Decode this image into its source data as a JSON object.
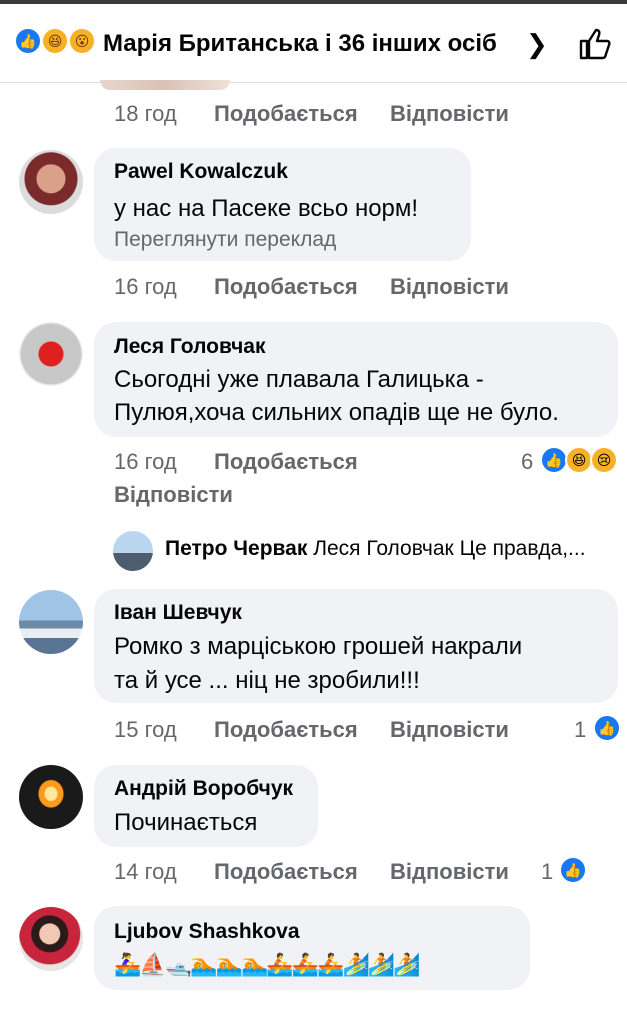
{
  "header": {
    "title": "Марія Британська і 36 інших осіб",
    "reactions": [
      "like-icon",
      "haha-icon",
      "wow-icon"
    ]
  },
  "actions": {
    "like": "Подобається",
    "reply": "Відповісти"
  },
  "top_meta": {
    "time": "18 год"
  },
  "comments": [
    {
      "author": "Pawel Kowalczuk",
      "text": [
        "у нас на Пасеке всьо норм!"
      ],
      "translate": "Переглянути переклад",
      "time": "16 год"
    },
    {
      "author": "Леся Головчак",
      "text": [
        "Сьогодні уже  плавала Галицька -",
        "Пулюя,хоча сильних опадів ще не було."
      ],
      "time": "16 год",
      "reaction_count": "6",
      "reactions": [
        "like-icon",
        "haha-icon",
        "sad-icon"
      ]
    },
    {
      "author": "Іван Шевчук",
      "text": [
        "Ромко з марціською грошей накрали",
        "та й усе ... ніц не зробили!!!"
      ],
      "time": "15 год",
      "reaction_count": "1",
      "reactions": [
        "like-icon"
      ]
    },
    {
      "author": "Андрій Воробчук",
      "text": [
        "Починається"
      ],
      "time": "14 год",
      "reaction_count": "1",
      "reactions": [
        "like-icon"
      ]
    },
    {
      "author": "Ljubov Shashkova",
      "text": [
        "🚣‍♀️⛵🛥️🏊🏊🏊🚣🚣🚣🏄🏄🏄"
      ]
    }
  ],
  "reply_preview": {
    "author": "Петро Червак",
    "text": "Леся Головчак Це правда,..."
  },
  "colors": {
    "bubble": "#f0f2f5",
    "meta": "#65676b",
    "like": "#1877f2",
    "emoji": "#f7b125"
  }
}
